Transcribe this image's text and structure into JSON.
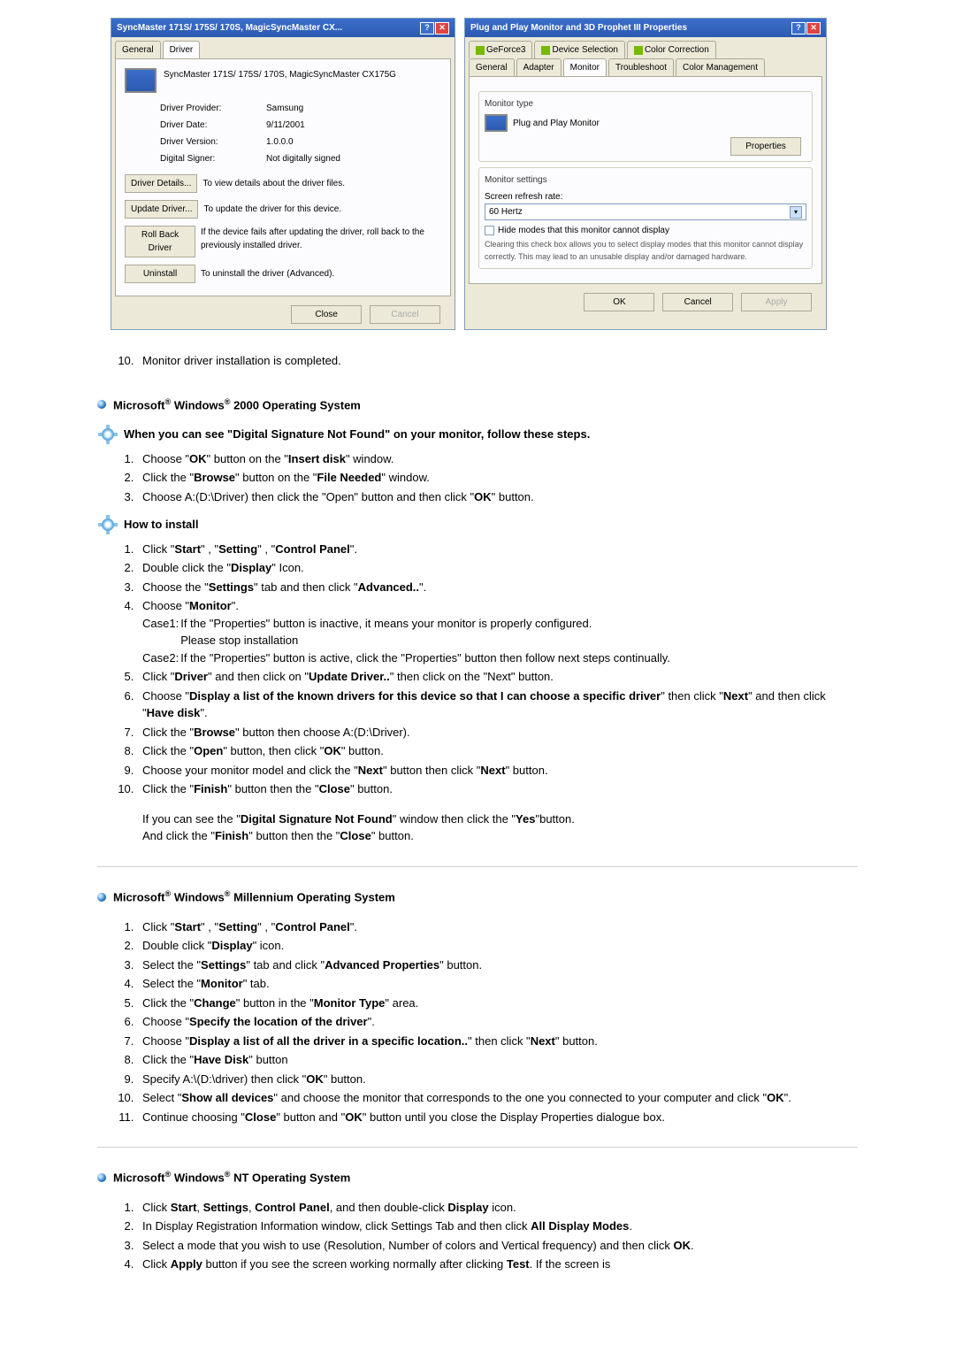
{
  "dialogs": {
    "left": {
      "title": "SyncMaster 171S/ 175S/ 170S, MagicSyncMaster CX...",
      "tabs": {
        "general": "General",
        "driver": "Driver"
      },
      "device_name": "SyncMaster 171S/ 175S/ 170S, MagicSyncMaster CX175G",
      "rows": {
        "provider_label": "Driver Provider:",
        "provider_value": "Samsung",
        "date_label": "Driver Date:",
        "date_value": "9/11/2001",
        "version_label": "Driver Version:",
        "version_value": "1.0.0.0",
        "signer_label": "Digital Signer:",
        "signer_value": "Not digitally signed"
      },
      "buttons": {
        "details": "Driver Details...",
        "details_desc": "To view details about the driver files.",
        "update": "Update Driver...",
        "update_desc": "To update the driver for this device.",
        "rollback": "Roll Back Driver",
        "rollback_desc": "If the device fails after updating the driver, roll back to the previously installed driver.",
        "uninstall": "Uninstall",
        "uninstall_desc": "To uninstall the driver (Advanced)."
      },
      "bottom": {
        "close": "Close",
        "cancel": "Cancel"
      }
    },
    "right": {
      "title": "Plug and Play Monitor and 3D Prophet III Properties",
      "tabs": {
        "geforce": "GeForce3",
        "devsel": "Device Selection",
        "colorcorr": "Color Correction",
        "general": "General",
        "adapter": "Adapter",
        "monitor": "Monitor",
        "troubleshoot": "Troubleshoot",
        "colormgmt": "Color Management"
      },
      "monitor_type_label": "Monitor type",
      "monitor_name": "Plug and Play Monitor",
      "properties_btn": "Properties",
      "settings_label": "Monitor settings",
      "refresh_label": "Screen refresh rate:",
      "refresh_value": "60 Hertz",
      "hide_modes": "Hide modes that this monitor cannot display",
      "hide_modes_note": "Clearing this check box allows you to select display modes that this monitor cannot display correctly. This may lead to an unusable display and/or damaged hardware.",
      "bottom": {
        "ok": "OK",
        "cancel": "Cancel",
        "apply": "Apply"
      }
    }
  },
  "step10": "Monitor driver installation is completed.",
  "sections": {
    "win2000": {
      "heading_pre": "Microsoft",
      "heading_mid": " Windows",
      "heading_post": " 2000 Operating System",
      "sig_heading": "When you can see \"Digital Signature Not Found\" on your monitor, follow these steps.",
      "sig_steps": [
        "Choose \"OK\" button on the \"Insert disk\" window.",
        "Click the \"Browse\" button on the \"File Needed\" window.",
        "Choose A:(D:\\Driver) then click the \"Open\" button and then click \"OK\" button."
      ],
      "install_heading": "How to install",
      "install_steps": {
        "s1": "Click \"Start\" , \"Setting\" , \"Control Panel\".",
        "s2": "Double click the \"Display\" Icon.",
        "s3": "Choose the \"Settings\" tab and then click \"Advanced..\".",
        "s4": "Choose \"Monitor\".",
        "case1_label": "Case1:",
        "case1": "If the \"Properties\" button is inactive, it means your monitor is properly configured. Please stop installation",
        "case2_label": "Case2:",
        "case2": "If the \"Properties\" button is active, click the \"Properties\" button then follow next steps continually.",
        "s5": "Click \"Driver\" and then click on \"Update Driver..\" then click on the \"Next\" button.",
        "s6": "Choose \"Display a list of the known drivers for this device so that I can choose a specific driver\" then click \"Next\" and then click \"Have disk\".",
        "s7": "Click the \"Browse\" button then choose A:(D:\\Driver).",
        "s8": "Click the \"Open\" button, then click \"OK\" button.",
        "s9": "Choose your monitor model and click the \"Next\" button then click \"Next\" button.",
        "s10": "Click the \"Finish\" button then the \"Close\" button.",
        "tail1": "If you can see the \"Digital Signature Not Found\" window then click the \"Yes\"button.",
        "tail2": "And click the \"Finish\" button then the \"Close\" button."
      }
    },
    "winme": {
      "heading_pre": "Microsoft",
      "heading_mid": " Windows",
      "heading_post": " Millennium Operating System",
      "steps": [
        "Click \"Start\" , \"Setting\" , \"Control Panel\".",
        "Double click \"Display\" icon.",
        "Select the \"Settings\" tab and click \"Advanced Properties\" button.",
        "Select the \"Monitor\" tab.",
        "Click the \"Change\" button in the \"Monitor Type\" area.",
        "Choose \"Specify the location of the driver\".",
        "Choose \"Display a list of all the driver in a specific location..\" then click \"Next\" button.",
        "Click the \"Have Disk\" button",
        "Specify A:\\(D:\\driver) then click \"OK\" button.",
        "Select \"Show all devices\" and choose the monitor that corresponds to the one you connected to your computer and click \"OK\".",
        "Continue choosing \"Close\" button and \"OK\" button until you close the Display Properties dialogue box."
      ]
    },
    "winnt": {
      "heading_pre": "Microsoft",
      "heading_mid": " Windows",
      "heading_post": " NT Operating System",
      "steps": [
        "Click Start, Settings, Control Panel, and then double-click Display icon.",
        "In Display Registration Information window, click Settings Tab and then click All Display Modes.",
        "Select a mode that you wish to use (Resolution, Number of colors and Vertical frequency) and then click OK.",
        "Click Apply button if you see the screen working normally after clicking Test. If the screen is"
      ]
    }
  }
}
